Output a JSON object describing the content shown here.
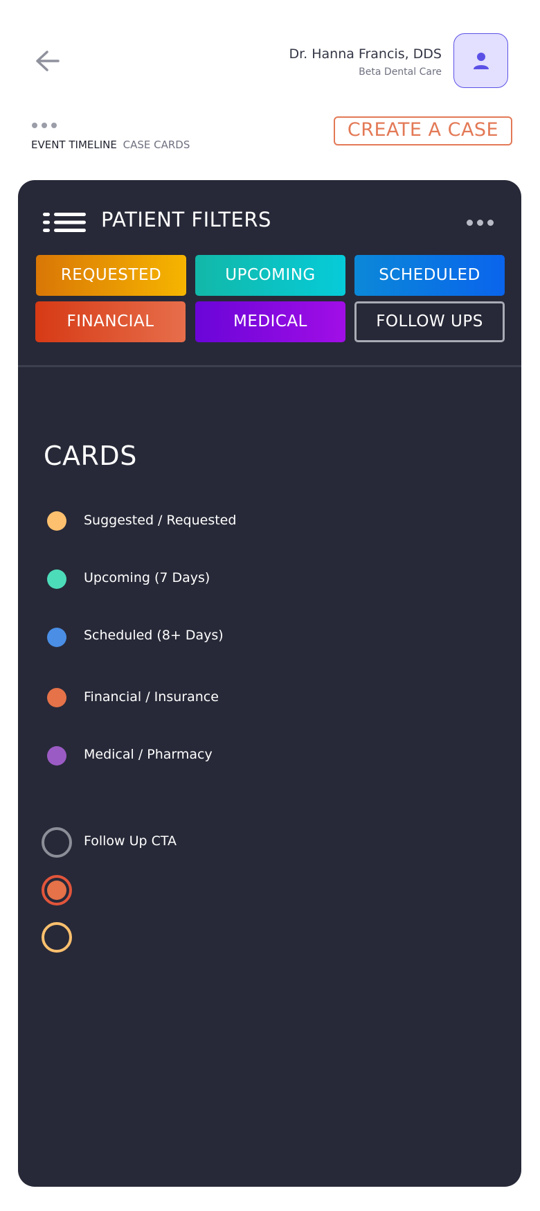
{
  "header": {
    "user_name": "Dr. Hanna Francis, DDS",
    "org": "Beta Dental Care",
    "tabs": [
      {
        "label": "EVENT TIMELINE",
        "active": true
      },
      {
        "label": "CASE CARDS",
        "active": false
      }
    ],
    "create_button": "CREATE A CASE"
  },
  "panel": {
    "title": "PATIENT FILTERS",
    "filters": [
      {
        "label": "REQUESTED"
      },
      {
        "label": "UPCOMING"
      },
      {
        "label": "SCHEDULED"
      },
      {
        "label": "FINANCIAL"
      },
      {
        "label": "MEDICAL"
      },
      {
        "label": "FOLLOW UPS"
      }
    ],
    "cards_title": "CARDS",
    "legend": [
      {
        "label": "Suggested / Requested",
        "color": "#fdc06e"
      },
      {
        "label": "Upcoming (7 Days)",
        "color": "#4ddcba"
      },
      {
        "label": "Scheduled (8+ Days)",
        "color": "#4a8ee6"
      },
      {
        "label": "Financial / Insurance",
        "color": "#e57248"
      },
      {
        "label": "Medical / Pharmacy",
        "color": "#9b5bc4"
      }
    ],
    "follow_up_label": "Follow Up CTA"
  },
  "colors": {
    "accent": "#e37956",
    "panel_bg": "#272938",
    "avatar_bg": "#e2dfff",
    "avatar_icon": "#5b50e6"
  },
  "icons": [
    "arrow-left-icon",
    "user-icon",
    "more-horizontal-icon",
    "list-icon"
  ]
}
